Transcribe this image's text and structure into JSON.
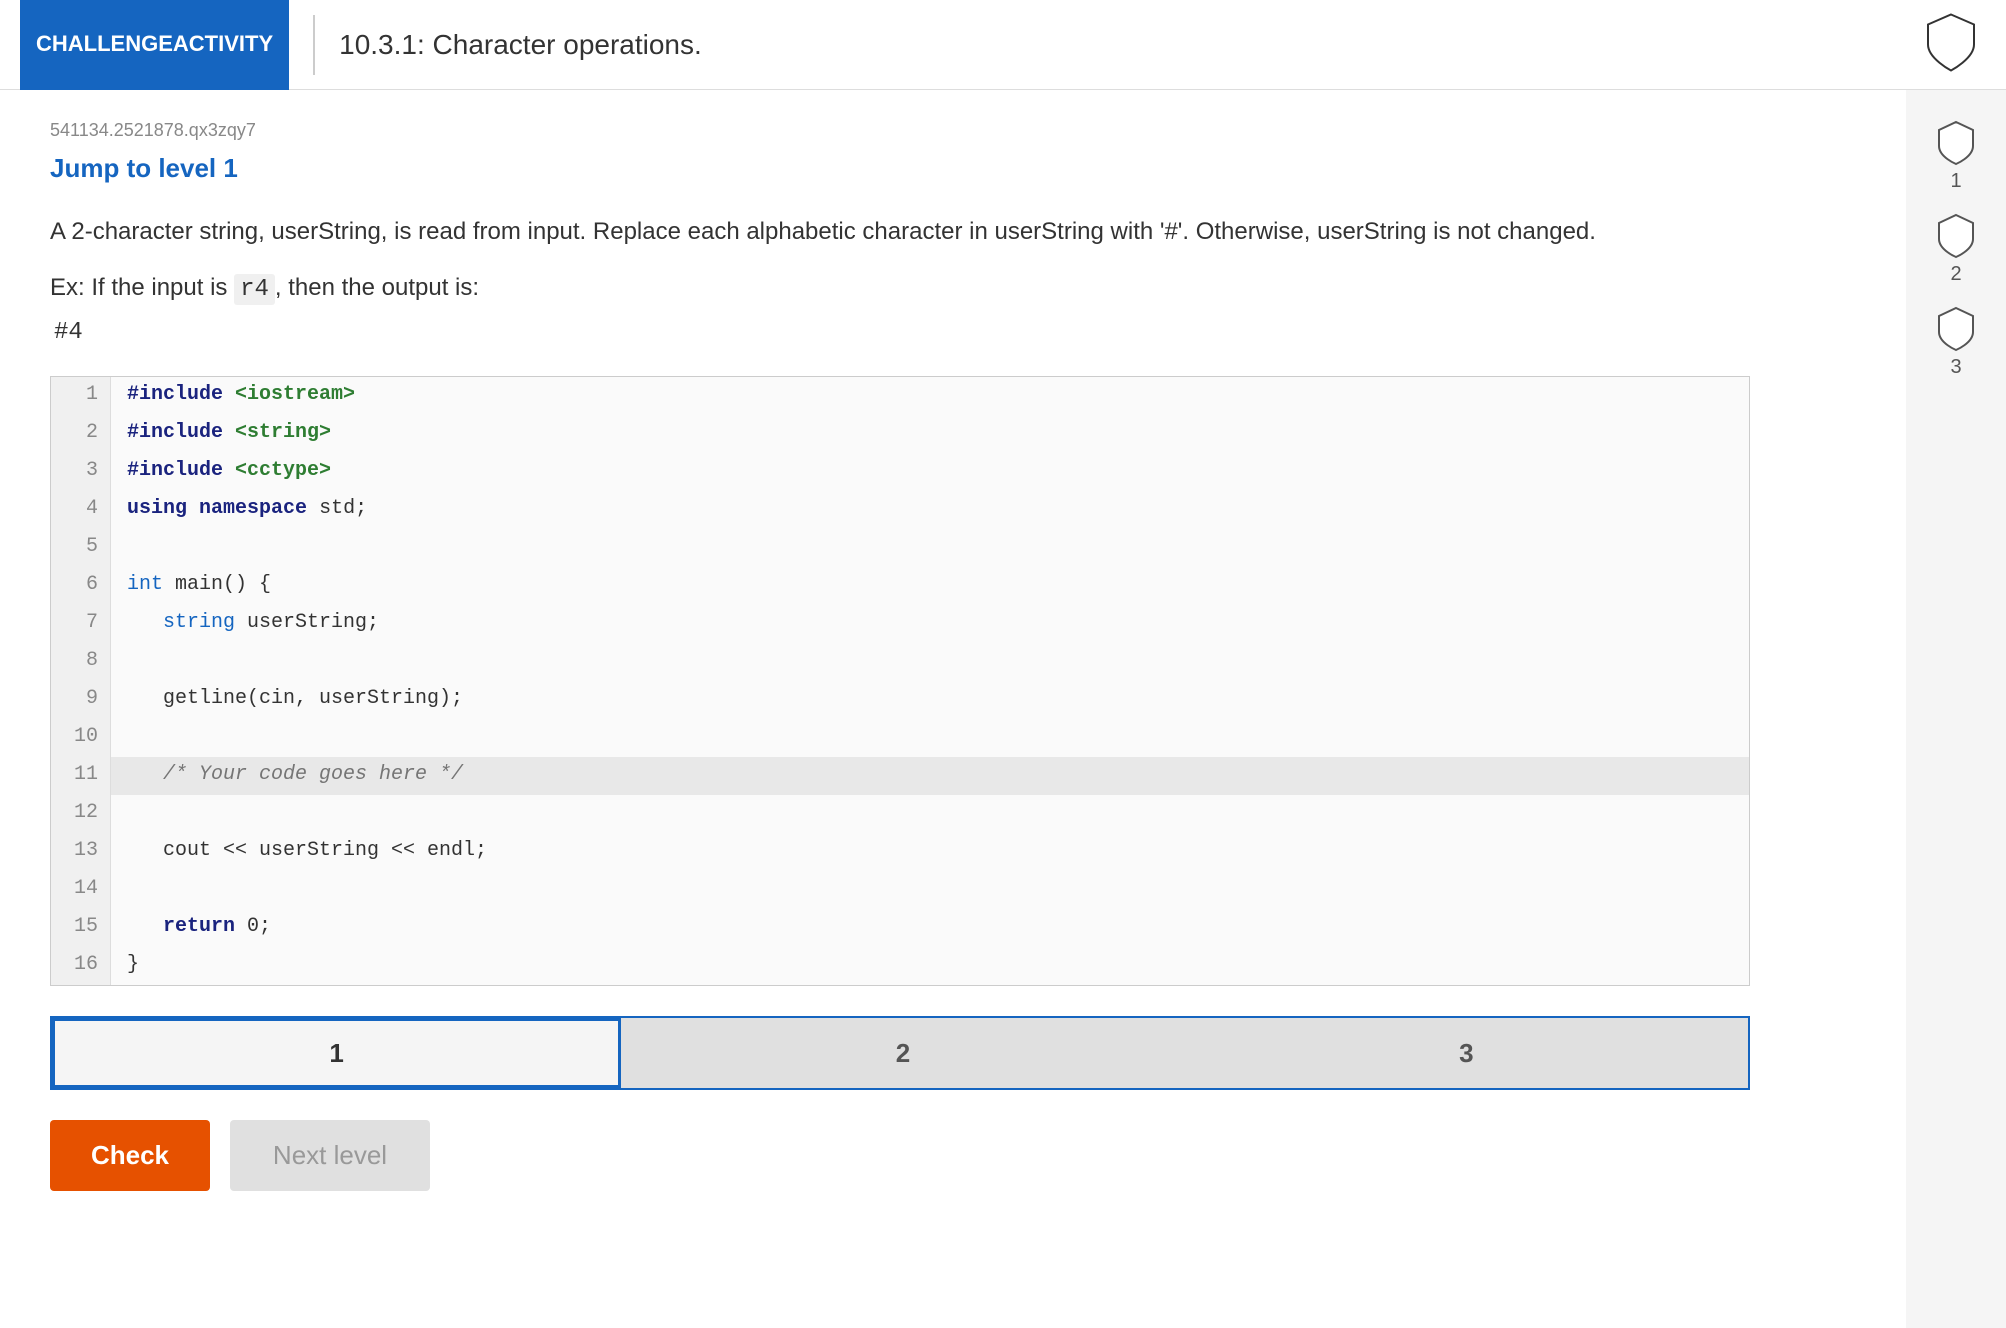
{
  "header": {
    "badge_line1": "CHALLENGE",
    "badge_line2": "ACTIVITY",
    "title": "10.3.1: Character operations.",
    "shield_label": "shield-header"
  },
  "activity": {
    "id": "541134.2521878.qx3zqy7",
    "jump_to_level": "Jump to level 1",
    "description": "A 2-character string, userString, is read from input. Replace each alphabetic character in userString with '#'. Otherwise, userString is not changed.",
    "example_intro": "Ex: If the input is ",
    "example_input": "r4",
    "example_input_suffix": ", then the output is:",
    "example_output": "#4"
  },
  "code": {
    "lines": [
      {
        "num": "1",
        "content": "#include <iostream>",
        "highlight": false
      },
      {
        "num": "2",
        "content": "#include <string>",
        "highlight": false
      },
      {
        "num": "3",
        "content": "#include <cctype>",
        "highlight": false
      },
      {
        "num": "4",
        "content": "using namespace std;",
        "highlight": false
      },
      {
        "num": "5",
        "content": "",
        "highlight": false
      },
      {
        "num": "6",
        "content": "int main() {",
        "highlight": false
      },
      {
        "num": "7",
        "content": "   string userString;",
        "highlight": false
      },
      {
        "num": "8",
        "content": "",
        "highlight": false
      },
      {
        "num": "9",
        "content": "   getline(cin, userString);",
        "highlight": false
      },
      {
        "num": "10",
        "content": "",
        "highlight": false
      },
      {
        "num": "11",
        "content": "   /* Your code goes here */",
        "highlight": true
      },
      {
        "num": "12",
        "content": "",
        "highlight": false
      },
      {
        "num": "13",
        "content": "   cout << userString << endl;",
        "highlight": false
      },
      {
        "num": "14",
        "content": "",
        "highlight": false
      },
      {
        "num": "15",
        "content": "   return 0;",
        "highlight": false
      },
      {
        "num": "16",
        "content": "}",
        "highlight": false
      }
    ]
  },
  "tabs": [
    {
      "label": "1",
      "active": true
    },
    {
      "label": "2",
      "active": false
    },
    {
      "label": "3",
      "active": false
    }
  ],
  "sidebar": {
    "levels": [
      {
        "num": "1"
      },
      {
        "num": "2"
      },
      {
        "num": "3"
      }
    ]
  },
  "buttons": {
    "check": "Check",
    "next_level": "Next level"
  }
}
